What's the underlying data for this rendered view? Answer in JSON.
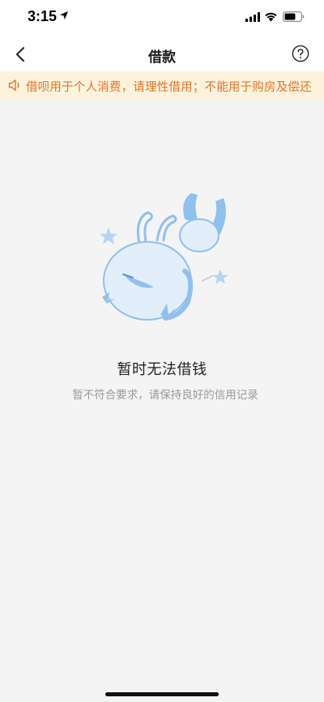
{
  "status_bar": {
    "time": "3:15"
  },
  "nav": {
    "title": "借款"
  },
  "notice": {
    "text": "借呗用于个人消费，请理性借用；不能用于购房及偿还"
  },
  "empty_state": {
    "title": "暂时无法借钱",
    "description": "暂不符合要求，请保持良好的信用记录"
  },
  "colors": {
    "notice_bg": "#fdf3dc",
    "notice_text": "#e0742a",
    "illustration_blue": "#8fc0ee"
  },
  "icons": [
    "location-arrow-icon",
    "signal-icon",
    "wifi-icon",
    "battery-icon",
    "back-chevron-icon",
    "help-circle-icon",
    "speaker-icon"
  ]
}
